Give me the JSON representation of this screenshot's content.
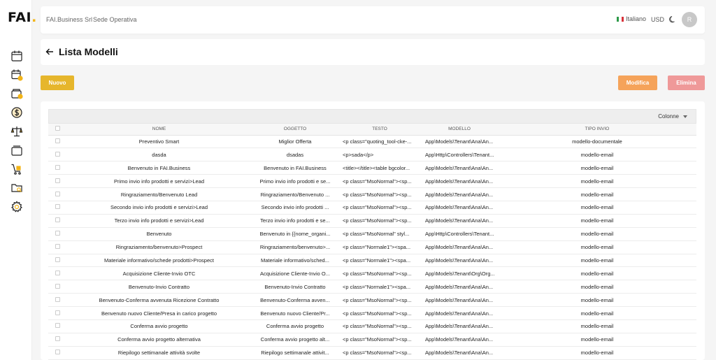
{
  "app": {
    "logo_text": "FAI",
    "logo_dot": ".",
    "company": "FAI.Business Srl",
    "site": "Sede Operativa",
    "language": "Italiano",
    "currency": "USD",
    "avatar_initial": "R"
  },
  "sidebar": {
    "icons": [
      "calendar-icon",
      "calendar-user-icon",
      "wallet-icon",
      "dollar-icon",
      "scale-icon",
      "folder-tray-icon",
      "cart-icon",
      "folder-search-icon",
      "gear-icon"
    ]
  },
  "page": {
    "title": "Lista Modelli"
  },
  "actions": {
    "new_label": "Nuovo",
    "edit_label": "Modifica",
    "delete_label": "Elimina"
  },
  "table": {
    "columns_label": "Colonne",
    "headers": [
      "NOME",
      "OGGETTO",
      "TESTO",
      "MODELLO",
      "TIPO INVIO"
    ],
    "rows": [
      [
        "Preventivo Smart",
        "Miglior Offerta",
        "<p class=\"quoting_tool-cke-...",
        "App\\Models\\Tenant\\Ana\\An...",
        "modello-documentale"
      ],
      [
        "dasda",
        "dsadas",
        "<p>sada</p>",
        "App\\Http\\Controllers\\Tenant...",
        "modello-email"
      ],
      [
        "Benvenuto in FAI.Business",
        "Benvenuto in FAI.Business",
        "<title></title><table bgcolor...",
        "App\\Models\\Tenant\\Ana\\An...",
        "modello-email"
      ],
      [
        "Primo invio info prodotti e servizi>Lead",
        "Primo invio info prodotti e se...",
        "<p class=\"MsoNormal\"><sp...",
        "App\\Models\\Tenant\\Ana\\An...",
        "modello-email"
      ],
      [
        "Ringraziamento/Benvenuto Lead",
        "Ringraziamento/Benvenuto ...",
        "<p class=\"MsoNormal\"><sp...",
        "App\\Models\\Tenant\\Ana\\An...",
        "modello-email"
      ],
      [
        "Secondo invio info prodotti e servizi>Lead",
        "Secondo invio info prodotti ...",
        "<p class=\"MsoNormal\"><sp...",
        "App\\Models\\Tenant\\Ana\\An...",
        "modello-email"
      ],
      [
        "Terzo invio info prodotti e servizi>Lead",
        "Terzo invio info prodotti e se...",
        "<p class=\"MsoNormal\"><sp...",
        "App\\Models\\Tenant\\Ana\\An...",
        "modello-email"
      ],
      [
        "Benvenuto",
        "Benvenuto in {{nome_organi...",
        "<p class=\"MsoNormal\" styl...",
        "App\\Http\\Controllers\\Tenant...",
        "modello-email"
      ],
      [
        "Ringraziamento/benvenuto>Prospect",
        "Ringraziamento/benvenuto>...",
        "<p class=\"Normale1\"><spa...",
        "App\\Models\\Tenant\\Ana\\An...",
        "modello-email"
      ],
      [
        "Materiale informativo/schede prodotti>Prospect",
        "Materiale informativo/sched...",
        "<p class=\"Normale1\"><spa...",
        "App\\Models\\Tenant\\Ana\\An...",
        "modello-email"
      ],
      [
        "Acquisizione Cliente-Invio OTC",
        "Acquisizione Cliente-Invio O...",
        "<p class=\"MsoNormal\"><sp...",
        "App\\Models\\Tenant\\Org\\Org...",
        "modello-email"
      ],
      [
        "Benvenuto-Invio Contratto",
        "Benvenuto-Invio Contratto",
        "<p class=\"Normale1\"><spa...",
        "App\\Models\\Tenant\\Ana\\An...",
        "modello-email"
      ],
      [
        "Benvenuto-Conferma avvenuta Ricezione Contratto",
        "Benvenuto-Conferma avven...",
        "<p class=\"MsoNormal\"><sp...",
        "App\\Models\\Tenant\\Ana\\An...",
        "modello-email"
      ],
      [
        "Benvenuto nuovo Cliente/Presa in carico progetto",
        "Benvenuto nuovo Cliente/Pr...",
        "<p class=\"MsoNormal\"><sp...",
        "App\\Models\\Tenant\\Ana\\An...",
        "modello-email"
      ],
      [
        "Conferma avvio progetto",
        "Conferma avvio progetto",
        "<p class=\"MsoNormal\"><sp...",
        "App\\Models\\Tenant\\Ana\\An...",
        "modello-email"
      ],
      [
        "Conferma avvio progetto alternativa",
        "Conferma avvio progetto alt...",
        "<p class=\"MsoNormal\"><sp...",
        "App\\Models\\Tenant\\Ana\\An...",
        "modello-email"
      ],
      [
        "Riepilogo settimanale attività svolte",
        "Riepilogo settimanale attivit...",
        "<p class=\"MsoNormal\"><sp...",
        "App\\Models\\Tenant\\Ana\\An...",
        "modello-email"
      ]
    ]
  },
  "colors": {
    "new_button": "#e6b62c",
    "edit_button": "#f5a35a",
    "delete_button": "#ef9999",
    "logo_dot": "#f2b418"
  }
}
